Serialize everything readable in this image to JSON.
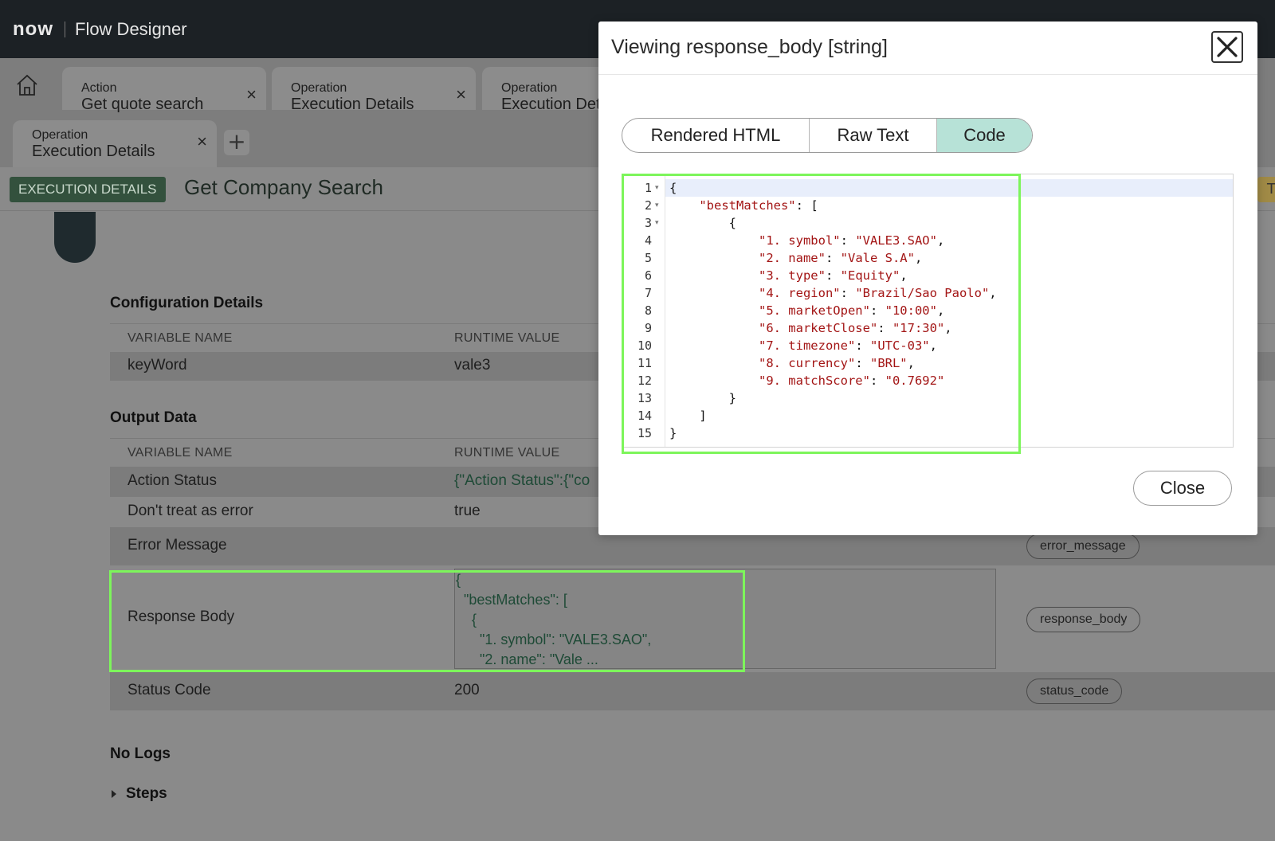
{
  "topbar": {
    "logo": "now",
    "app_title": "Flow Designer"
  },
  "tabs": [
    {
      "type": "Action",
      "name": "Get quote search"
    },
    {
      "type": "Operation",
      "name": "Execution Details"
    },
    {
      "type": "Operation",
      "name": "Execution Det"
    },
    {
      "type": "Operation",
      "name": "Execution Details"
    }
  ],
  "tab_close_glyph": "×",
  "add_tab_glyph": "+",
  "header": {
    "badge": "EXECUTION DETAILS",
    "title": "Get Company Search",
    "right_tag": "T"
  },
  "config": {
    "title": "Configuration Details",
    "col_name": "VARIABLE NAME",
    "col_value": "RUNTIME VALUE",
    "rows": [
      {
        "name": "keyWord",
        "value": "vale3"
      }
    ]
  },
  "output": {
    "title": "Output Data",
    "col_name": "VARIABLE NAME",
    "col_value": "RUNTIME VALUE",
    "rows": [
      {
        "name": "Action Status",
        "value": "{\"Action Status\":{\"co",
        "pill": ""
      },
      {
        "name": "Don't treat as error",
        "value": "true",
        "pill": ""
      },
      {
        "name": "Error Message",
        "value": "",
        "pill": "error_message"
      },
      {
        "name": "Response Body",
        "value": "{\n  \"bestMatches\": [\n    {\n      \"1. symbol\": \"VALE3.SAO\",\n      \"2. name\": \"Vale ...",
        "pill": "response_body"
      },
      {
        "name": "Status Code",
        "value": "200",
        "pill": "status_code"
      }
    ]
  },
  "logs_title": "No Logs",
  "steps_label": "Steps",
  "modal": {
    "title": "Viewing response_body [string]",
    "segments": [
      "Rendered HTML",
      "Raw Text",
      "Code"
    ],
    "active_segment": "Code",
    "close_label": "Close",
    "code_lines": [
      {
        "n": "1",
        "text": "{"
      },
      {
        "n": "2",
        "text": "    \"bestMatches\": ["
      },
      {
        "n": "3",
        "text": "        {"
      },
      {
        "n": "4",
        "text": "            \"1. symbol\": \"VALE3.SAO\","
      },
      {
        "n": "5",
        "text": "            \"2. name\": \"Vale S.A\","
      },
      {
        "n": "6",
        "text": "            \"3. type\": \"Equity\","
      },
      {
        "n": "7",
        "text": "            \"4. region\": \"Brazil/Sao Paolo\","
      },
      {
        "n": "8",
        "text": "            \"5. marketOpen\": \"10:00\","
      },
      {
        "n": "9",
        "text": "            \"6. marketClose\": \"17:30\","
      },
      {
        "n": "10",
        "text": "            \"7. timezone\": \"UTC-03\","
      },
      {
        "n": "11",
        "text": "            \"8. currency\": \"BRL\","
      },
      {
        "n": "12",
        "text": "            \"9. matchScore\": \"0.7692\""
      },
      {
        "n": "13",
        "text": "        }"
      },
      {
        "n": "14",
        "text": "    ]"
      },
      {
        "n": "15",
        "text": "}"
      }
    ]
  },
  "colors": {
    "topbar": "#1c2125",
    "badge": "#33513d",
    "active_segment": "#b7e2d7",
    "highlight": "#7df55b",
    "string": "#a31515"
  }
}
